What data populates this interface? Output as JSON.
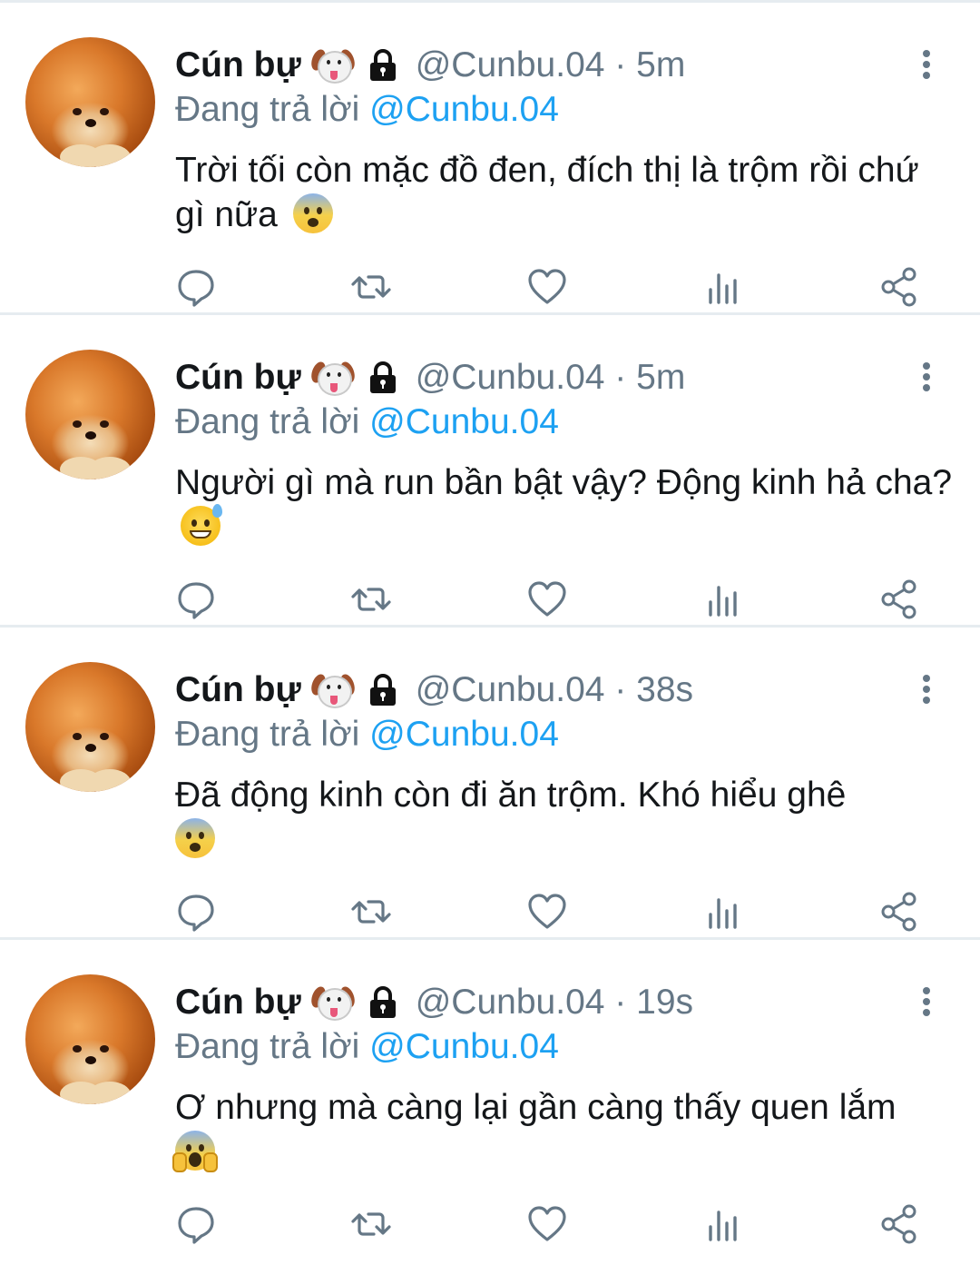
{
  "tweets": [
    {
      "name": "Cún bự",
      "handle": "@Cunbu.04",
      "time": "5m",
      "reply_prefix": "Đang trả lời",
      "reply_to": "@Cunbu.04",
      "text": "Trời tối còn mặc đồ đen, đích thị là trộm rồi chứ gì nữa",
      "emoji": "fearful-face-icon"
    },
    {
      "name": "Cún bự",
      "handle": "@Cunbu.04",
      "time": "5m",
      "reply_prefix": "Đang trả lời",
      "reply_to": "@Cunbu.04",
      "text": "Người gì mà run bần bật vậy? Động kinh hả cha?",
      "emoji": "grinning-sweat-icon"
    },
    {
      "name": "Cún bự",
      "handle": "@Cunbu.04",
      "time": "38s",
      "reply_prefix": "Đang trả lời",
      "reply_to": "@Cunbu.04",
      "text": "Đã động kinh còn đi ăn trộm. Khó hiểu ghê",
      "emoji": "fearful-face-icon"
    },
    {
      "name": "Cún bự",
      "handle": "@Cunbu.04",
      "time": "19s",
      "reply_prefix": "Đang trả lời",
      "reply_to": "@Cunbu.04",
      "text": "Ơ nhưng mà càng lại gần càng thấy quen lắm",
      "emoji": "screaming-face-icon"
    }
  ],
  "separator": "·",
  "colors": {
    "text": "#14171a",
    "secondary": "#657786",
    "accent": "#1da1f2",
    "divider": "#e6ecf0"
  }
}
